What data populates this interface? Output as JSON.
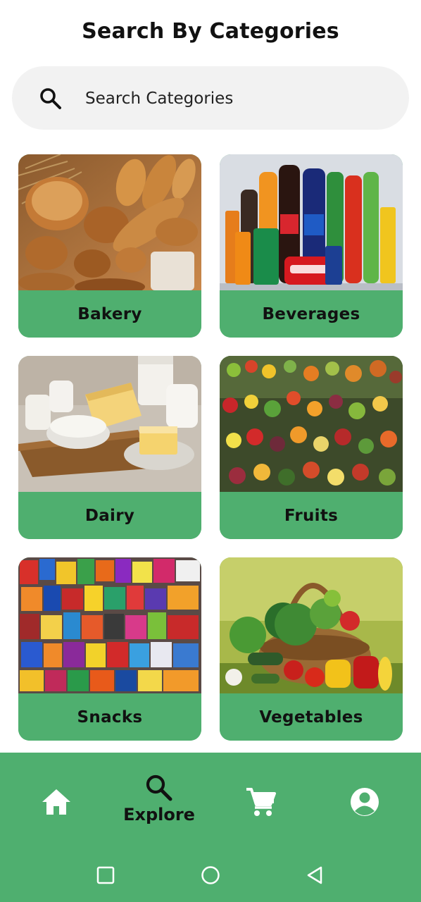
{
  "header": {
    "title": "Search By Categories"
  },
  "search": {
    "placeholder": "Search Categories",
    "icon": "search-icon"
  },
  "categories": [
    {
      "label": "Bakery",
      "image": "bakery-photo"
    },
    {
      "label": "Beverages",
      "image": "beverages-photo"
    },
    {
      "label": "Dairy",
      "image": "dairy-photo"
    },
    {
      "label": "Fruits",
      "image": "fruits-photo"
    },
    {
      "label": "Snacks",
      "image": "snacks-photo"
    },
    {
      "label": "Vegetables",
      "image": "vegetables-photo"
    }
  ],
  "bottom_nav": {
    "items": [
      {
        "icon": "home-icon",
        "label": ""
      },
      {
        "icon": "search-icon",
        "label": "Explore",
        "active": true
      },
      {
        "icon": "cart-icon",
        "label": ""
      },
      {
        "icon": "account-icon",
        "label": ""
      }
    ]
  },
  "colors": {
    "accent": "#4faf6f",
    "search_bg": "#f2f2f2",
    "text": "#111111",
    "icon_light": "#ffffff"
  }
}
